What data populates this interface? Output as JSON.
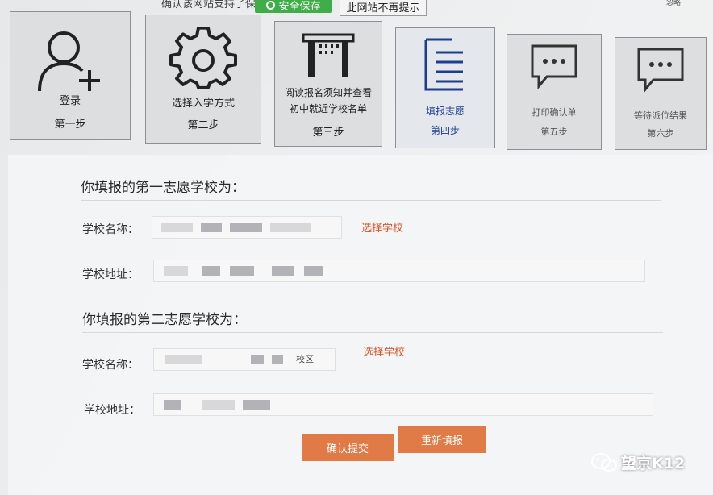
{
  "browser_bar": {
    "left_text": "确认该网站支持了保存设置)",
    "save_button": "安全保存",
    "dismiss_button": "此网站不再提示",
    "right_text": "忽略"
  },
  "steps": [
    {
      "label": "登录",
      "step": "第一步",
      "icon": "user-add-icon"
    },
    {
      "label": "选择入学方式",
      "step": "第二步",
      "icon": "gear-icon"
    },
    {
      "label": "阅读报名须知并查看初中就近学校名单",
      "label_line1": "阅读报名须知并查看",
      "label_line2": "初中就近学校名单",
      "step": "第三步",
      "icon": "building-icon"
    },
    {
      "label": "填报志愿",
      "step": "第四步",
      "icon": "document-list-icon"
    },
    {
      "label": "打印确认单",
      "step": "第五步",
      "icon": "chat-bubble-icon"
    },
    {
      "label": "等待派位结果",
      "step": "第六步",
      "icon": "chat-bubble-icon"
    }
  ],
  "form": {
    "first_choice": {
      "title": "你填报的第一志愿学校为：",
      "name_label": "学校名称：",
      "name_value": "",
      "pick_link": "选择学校",
      "address_label": "学校地址：",
      "address_value": ""
    },
    "second_choice": {
      "title": "你填报的第二志愿学校为：",
      "name_label": "学校名称：",
      "name_value": "校区",
      "pick_link": "选择学校",
      "address_label": "学校地址：",
      "address_value": ""
    },
    "submit_button": "确认提交",
    "reset_button": "重新填报"
  },
  "watermark": {
    "text": "望京K12",
    "icon": "wechat-icon"
  },
  "colors": {
    "accent_orange": "#e07a47",
    "link_red": "#d4542a",
    "active_blue": "#1d3e8f",
    "save_green": "#3fae49"
  }
}
